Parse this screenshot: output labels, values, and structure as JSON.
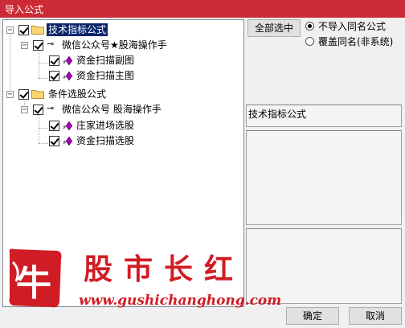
{
  "window": {
    "title": "导入公式"
  },
  "tree": {
    "root1": {
      "label": "技术指标公式",
      "child": {
        "label": "微信公众号★股海操作手",
        "items": [
          "资金扫描副图",
          "资金扫描主图"
        ]
      }
    },
    "root2": {
      "label": "条件选股公式",
      "child": {
        "label": "微信公众号 股海操作手",
        "items": [
          "庄家进场选股",
          "资金扫描选股"
        ]
      }
    }
  },
  "buttons": {
    "select_all": "全部选中",
    "ok": "确定",
    "cancel": "取消"
  },
  "options": {
    "no_import": "不导入同名公式",
    "overwrite": "覆盖同名(非系统)",
    "selected": "no_import"
  },
  "info": {
    "category_label": "技术指标公式"
  },
  "watermark": {
    "logo_char": "牛",
    "brand": "股市长红",
    "url": "www.gushichanghong.com"
  },
  "colors": {
    "titlebar": "#cc2a36",
    "selection": "#0a246a",
    "watermark": "#d01c24"
  }
}
